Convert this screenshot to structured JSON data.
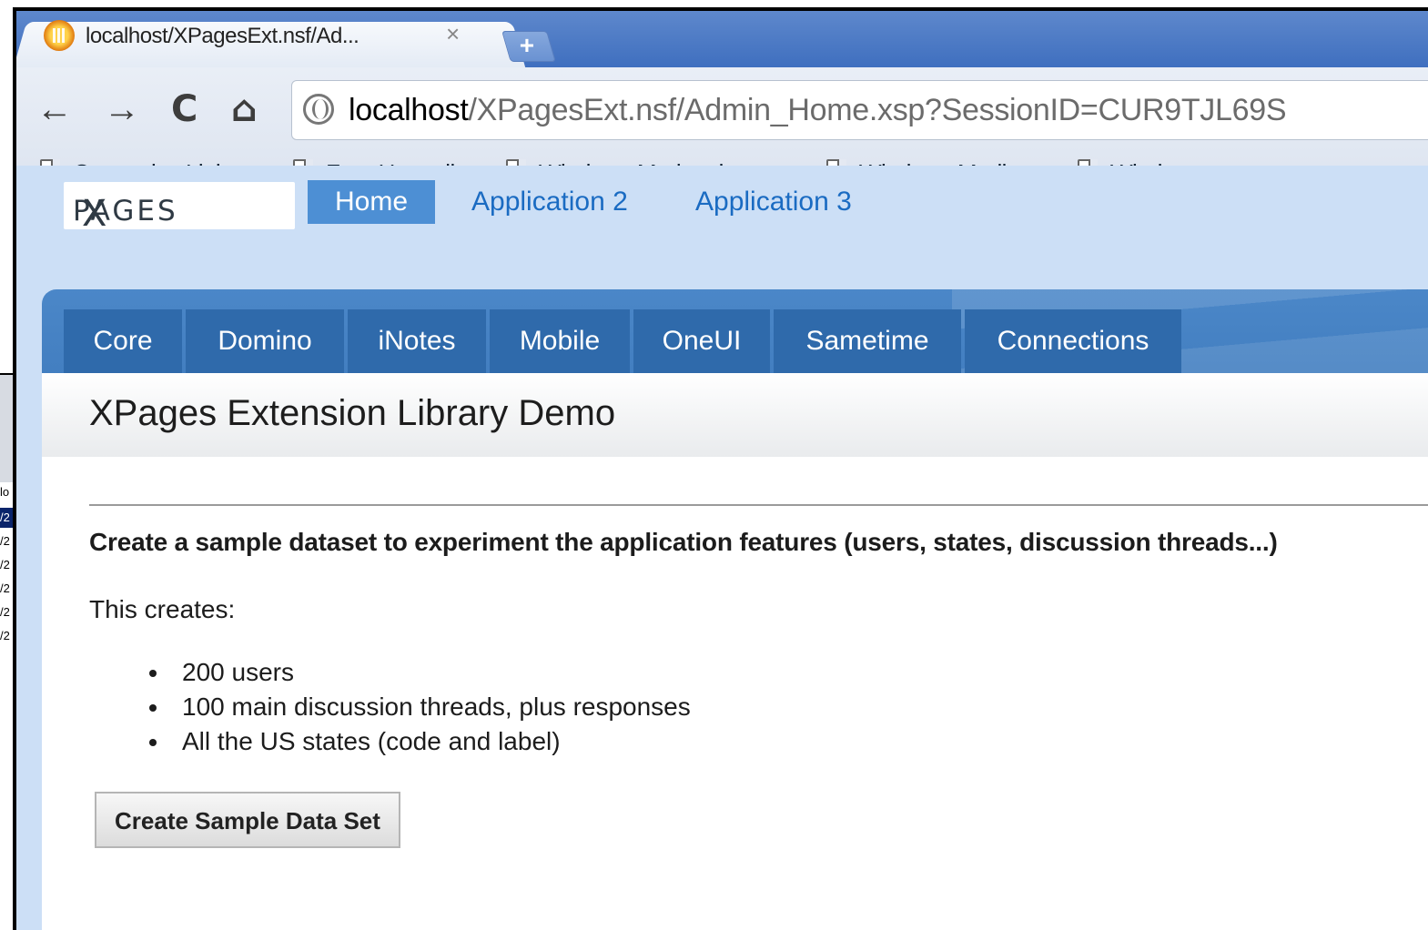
{
  "background": {
    "fragment_rows": [
      "lo",
      "/2",
      "/2",
      "/2",
      "/2",
      "/2",
      "/2"
    ]
  },
  "browser": {
    "tab": {
      "title": "localhost/XPagesExt.nsf/Ad...",
      "close": "×",
      "favicon": "xpages-favicon-icon"
    },
    "new_tab": "+",
    "nav": {
      "back": "←",
      "forward": "→",
      "reload": "C",
      "home": "⌂"
    },
    "omnibox": {
      "host": "localhost",
      "path": "/XPagesExt.nsf/Admin_Home.xsp?SessionID=CUR9TJL69S"
    },
    "bookmarks": [
      "Customize Links",
      "Free Hotmail",
      "Windows Marketplace",
      "Windows Media",
      "Windows"
    ]
  },
  "app": {
    "logo_first": "X",
    "logo_rest": "PAGES",
    "top_nav": [
      "Home",
      "Application 2",
      "Application 3"
    ],
    "sub_tabs": [
      "Core",
      "Domino",
      "iNotes",
      "Mobile",
      "OneUI",
      "Sametime",
      "Connections"
    ],
    "page_title": "XPages Extension Library Demo",
    "lead": "Create a sample dataset to experiment the application features (users, states, discussion threads...)",
    "creates_label": "This creates:",
    "bullets": [
      "200 users",
      "100 main discussion threads, plus responses",
      "All the US states (code and label)"
    ],
    "button_label": "Create Sample Data Set"
  },
  "colors": {
    "tabstrip": "#4a7cc8",
    "page_bg": "#ccdff6",
    "active_nav": "#4d8fd4",
    "subtab_bg": "#2f6aab",
    "link": "#1a6bc2"
  }
}
